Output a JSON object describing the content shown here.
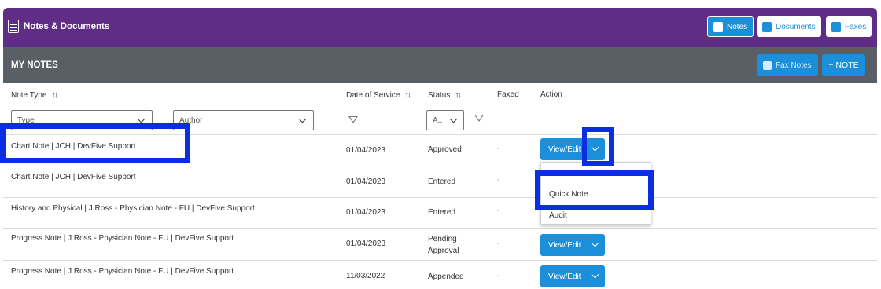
{
  "app": {
    "title": "Notes & Documents",
    "buttons": {
      "notes": "Notes",
      "documents": "Documents",
      "faxes": "Faxes"
    }
  },
  "my_notes": {
    "title": "MY NOTES",
    "fax_notes_label": "Fax Notes",
    "add_note_label": "+ NOTE"
  },
  "columns": {
    "note_type": "Note Type",
    "date_of_service": "Date of Service",
    "status": "Status",
    "faxed": "Faxed",
    "action": "Action"
  },
  "filters": {
    "type_placeholder": "Type",
    "author_placeholder": "Author",
    "status_value": "A.."
  },
  "rows": [
    {
      "note_type": "Chart Note | JCH | DevFive Support",
      "date_of_service": "01/04/2023",
      "status": "Approved",
      "faxed": "-",
      "action": "View/Edit"
    },
    {
      "note_type": "Chart Note | JCH | DevFive Support",
      "date_of_service": "01/04/2023",
      "status": "Entered",
      "faxed": "-",
      "action": ""
    },
    {
      "note_type": "History and Physical | J Ross - Physician Note - FU | DevFive Support",
      "date_of_service": "01/04/2023",
      "status": "Entered",
      "faxed": "-",
      "action": ""
    },
    {
      "note_type": "Progress Note | J Ross - Physician Note - FU | DevFive Support",
      "date_of_service": "01/04/2023",
      "status_line1": "Pending",
      "status_line2": "Approval",
      "faxed": "-",
      "action": "View/Edit"
    },
    {
      "note_type": "Progress Note | J Ross - Physician Note - FU | DevFive Support",
      "date_of_service": "11/03/2022",
      "status": "Appended",
      "faxed": "-",
      "action": "View/Edit"
    }
  ],
  "action_menu": {
    "items": [
      "Quick Note",
      "Audit"
    ]
  },
  "colors": {
    "header_purple": "#5f2c86",
    "bar_gray": "#5a5f66",
    "primary_blue": "#1c8fdb",
    "highlight_blue": "#0a2fe0"
  },
  "icons": [
    "document-icon",
    "notes-icon",
    "documents-icon",
    "fax-icon",
    "sort-icon",
    "chevron-down-icon",
    "filter-icon",
    "clear-filter-icon"
  ]
}
